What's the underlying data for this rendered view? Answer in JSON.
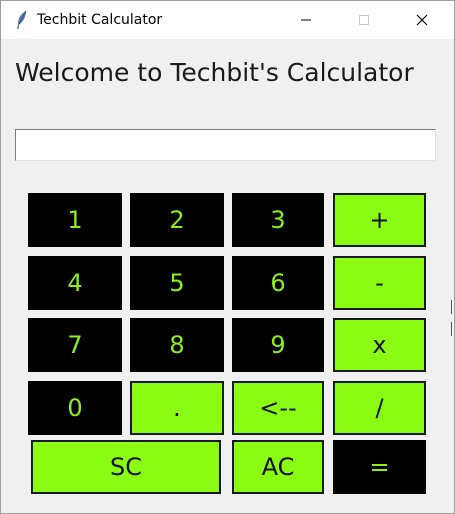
{
  "window": {
    "title": "Techbit Calculator",
    "icon": "feather-icon",
    "controls": [
      "minimize-icon",
      "maximize-icon",
      "close-icon"
    ]
  },
  "welcome_text": "Welcome to Techbit's Calculator",
  "display": {
    "value": ""
  },
  "colors": {
    "lime": "#8afc14",
    "dark": "#000000",
    "digit_text": "#8df014",
    "background": "#f0f0f0"
  },
  "keys": {
    "k1": "1",
    "k2": "2",
    "k3": "3",
    "plus": "+",
    "k4": "4",
    "k5": "5",
    "k6": "6",
    "minus": "-",
    "k7": "7",
    "k8": "8",
    "k9": "9",
    "multiply": "x",
    "k0": "0",
    "dot": ".",
    "back": "<--",
    "divide": "/",
    "sc": "SC",
    "ac": "AC",
    "equals": "="
  }
}
